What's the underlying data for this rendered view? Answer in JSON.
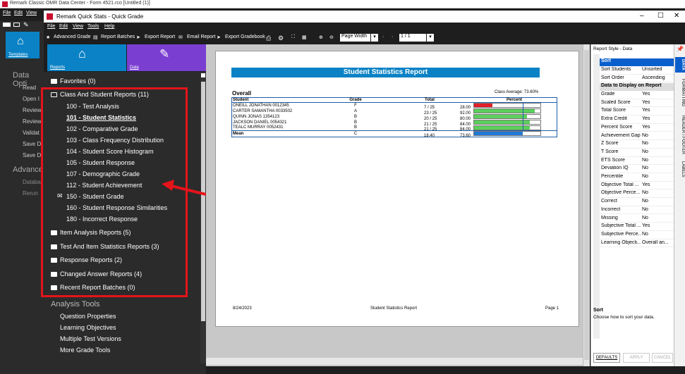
{
  "outer": {
    "title": "Remark Classic OMR Data Center - Form 4521.rco [Untitled (1)]",
    "menu": [
      "File",
      "Edit",
      "View"
    ],
    "templates_label": "Templates",
    "side_items": [
      "Data Opti",
      "Read",
      "Open I",
      "Review",
      "Review",
      "Validat",
      "Save D",
      "Save D"
    ],
    "advanced_label": "Advance",
    "advanced_items": [
      "Databa",
      "Rerun"
    ]
  },
  "window": {
    "title": "Remark Quick Stats - Quick Grade",
    "menu": [
      "File",
      "Edit",
      "View",
      "Tools",
      "Help"
    ],
    "controls": [
      "–",
      "☐",
      "✕"
    ]
  },
  "toolbar": {
    "advanced_grade": "Advanced Grade",
    "report_batches": "Report Batches",
    "export_report": "Export Report",
    "email_report": "Email Report",
    "export_gradebook": "Export Gradebook",
    "zoom_mode": "Page Width",
    "page": "1 / 1"
  },
  "tiles": {
    "reports": "Reports",
    "data": "Data"
  },
  "reports_tree": {
    "favorites": "Favorites (0)",
    "class_reports": "Class And Student Reports (11)",
    "class_items": [
      "100 - Test Analysis",
      "101 - Student Statistics",
      "102 - Comparative Grade",
      "103 - Class Frequency Distribution",
      "104 - Student Score Histogram",
      "105 - Student Response",
      "107 - Demographic Grade",
      "112 - Student Achievement",
      "150 - Student Grade",
      "160 - Student Response Similarities",
      "180 - Incorrect Response"
    ],
    "other_folders": [
      "Item Analysis Reports (5)",
      "Test And Item Statistics Reports (3)",
      "Response Reports (2)",
      "Changed Answer Reports (4)",
      "Recent Report Batches (0)"
    ]
  },
  "analysis_tools": {
    "header": "Analysis Tools",
    "items": [
      "Question Properties",
      "Learning Objectives",
      "Multiple Test Versions",
      "More Grade Tools"
    ]
  },
  "report": {
    "title": "Student Statistics Report",
    "section": "Overall",
    "class_average": "Class Average: 73.60%",
    "columns": [
      "Student",
      "Grade",
      "Total",
      "Percent"
    ],
    "rows": [
      {
        "student": "ONEILL JONATHAN 0012345",
        "grade": "F",
        "total": "7  /  25",
        "pct": "28.00",
        "value": 0.28,
        "color": "#e0202a"
      },
      {
        "student": "CARTER SAMANTHA 0033502",
        "grade": "A",
        "total": "23  /  25",
        "pct": "92.00",
        "value": 0.92,
        "color": "#5ccf5c"
      },
      {
        "student": "QUINN JONAS 1354123",
        "grade": "B",
        "total": "20  /  25",
        "pct": "80.00",
        "value": 0.8,
        "color": "#5ccf5c"
      },
      {
        "student": "JACKSON DANIEL 0054321",
        "grade": "B",
        "total": "21  /  25",
        "pct": "84.00",
        "value": 0.84,
        "color": "#5ccf5c"
      },
      {
        "student": "TEALC MURRAY 0052431",
        "grade": "B",
        "total": "21  /  25",
        "pct": "84.00",
        "value": 0.84,
        "color": "#5ccf5c"
      }
    ],
    "mean": {
      "label": "Mean",
      "grade": "C",
      "total": "18.40",
      "pct": "73.60",
      "value": 0.736,
      "color": "#1f7bd6"
    },
    "footer_date": "8/24/2023",
    "footer_title": "Student Statistics Report",
    "footer_page": "Page 1"
  },
  "right_panel": {
    "title": "Report Style - Data",
    "tabs": [
      "DATA",
      "FORMATTING",
      "HEADER / FOOTER",
      "LABELS"
    ],
    "sort_header": "Sort",
    "sort_rows": [
      [
        "Sort Students",
        "Unsorted"
      ],
      [
        "Sort Order",
        "Ascending"
      ]
    ],
    "display_header": "Data to Display on Report",
    "display_rows": [
      [
        "Grade",
        "Yes"
      ],
      [
        "Scaled Score",
        "Yes"
      ],
      [
        "Total Score",
        "Yes"
      ],
      [
        "Extra Credit",
        "Yes"
      ],
      [
        "Percent Score",
        "Yes"
      ],
      [
        "Achievement Gap",
        "No"
      ],
      [
        "Z Score",
        "No"
      ],
      [
        "T Score",
        "No"
      ],
      [
        "ETS Score",
        "No"
      ],
      [
        "Deviation IQ",
        "No"
      ],
      [
        "Percentile",
        "No"
      ],
      [
        "Objective Total ...",
        "Yes"
      ],
      [
        "Objective Perce...",
        "No"
      ],
      [
        "Correct",
        "No"
      ],
      [
        "Incorrect",
        "No"
      ],
      [
        "Missing",
        "No"
      ],
      [
        "Subjective Total ...",
        "Yes"
      ],
      [
        "Subjective Perce...",
        "No"
      ],
      [
        "Learning Objecti...",
        "Overall an..."
      ]
    ],
    "desc_title": "Sort",
    "desc_text": "Choose how to sort your data.",
    "buttons": [
      "DEFAULTS",
      "APPLY",
      "CANCEL"
    ]
  },
  "colors": {
    "accent_blue": "#0b82c5",
    "data_purple": "#7a3fd1",
    "highlight_red": "#e3141a"
  }
}
